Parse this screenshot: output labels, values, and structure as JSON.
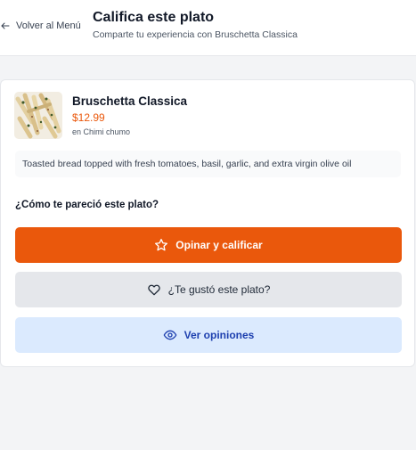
{
  "header": {
    "back_label": "Volver al Menú",
    "title": "Califica este plato",
    "subtitle": "Comparte tu experiencia con Bruschetta Classica"
  },
  "dish": {
    "name": "Bruschetta Classica",
    "price": "$12.99",
    "restaurant": "en Chimi chumo",
    "description": "Toasted bread topped with fresh tomatoes, basil, garlic, and extra virgin olive oil"
  },
  "prompt": {
    "question": "¿Cómo te pareció este plato?"
  },
  "actions": {
    "rate_label": "Opinar y calificar",
    "like_label": "¿Te gustó este plato?",
    "reviews_label": "Ver opiniones"
  },
  "icons": {
    "back": "arrow-left-icon",
    "rate": "star-icon",
    "like": "heart-icon",
    "reviews": "eye-icon"
  },
  "colors": {
    "accent": "#ea580c",
    "secondary": "#e5e7eb",
    "info_bg": "#dbeafe",
    "info_text": "#1e40af"
  }
}
